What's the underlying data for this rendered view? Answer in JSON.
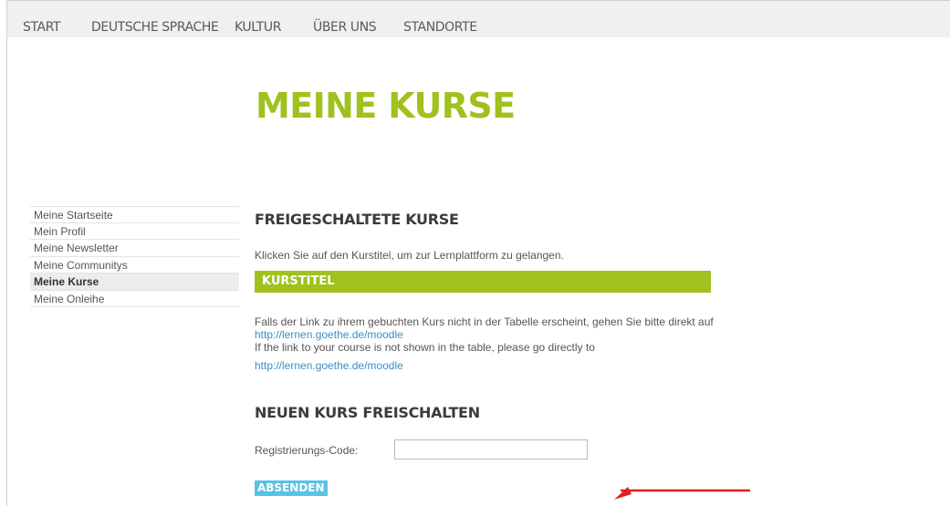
{
  "topnav": {
    "items": [
      "START",
      "DEUTSCHE SPRACHE",
      "KULTUR",
      "ÜBER UNS",
      "STANDORTE"
    ]
  },
  "page": {
    "title": "MEINE KURSE"
  },
  "sidebar": {
    "items": [
      {
        "label": "Meine Startseite",
        "active": false
      },
      {
        "label": "Mein Profil",
        "active": false
      },
      {
        "label": "Meine Newsletter",
        "active": false
      },
      {
        "label": "Meine Communitys",
        "active": false
      },
      {
        "label": "Meine Kurse",
        "active": true
      },
      {
        "label": "Meine Onleihe",
        "active": false
      }
    ]
  },
  "unlocked_courses": {
    "heading": "FREIGESCHALTETE KURSE",
    "intro": "Klicken Sie auf den Kurstitel, um zur Lernplattform zu gelangen.",
    "table": {
      "columns": [
        "KURSTITEL"
      ],
      "rows": []
    },
    "note_de": "Falls der Link zu ihrem gebuchten Kurs nicht in der Tabelle erscheint, gehen Sie bitte direkt auf",
    "link_1": "http://lernen.goethe.de/moodle",
    "note_en": "If the link to your course is not shown in the table, please go directly to",
    "link_2": "http://lernen.goethe.de/moodle"
  },
  "new_course": {
    "heading": "NEUEN KURS FREISCHALTEN",
    "code_label": "Registrierungs-Code:",
    "code_value": "",
    "submit_label": "ABSENDEN"
  },
  "colors": {
    "accent_green": "#a0c11e",
    "button_blue": "#57c2e6",
    "link_blue": "#3a8fc6",
    "annotation_red": "#e02020"
  },
  "annotation": {
    "icon": "red-arrow-icon"
  }
}
